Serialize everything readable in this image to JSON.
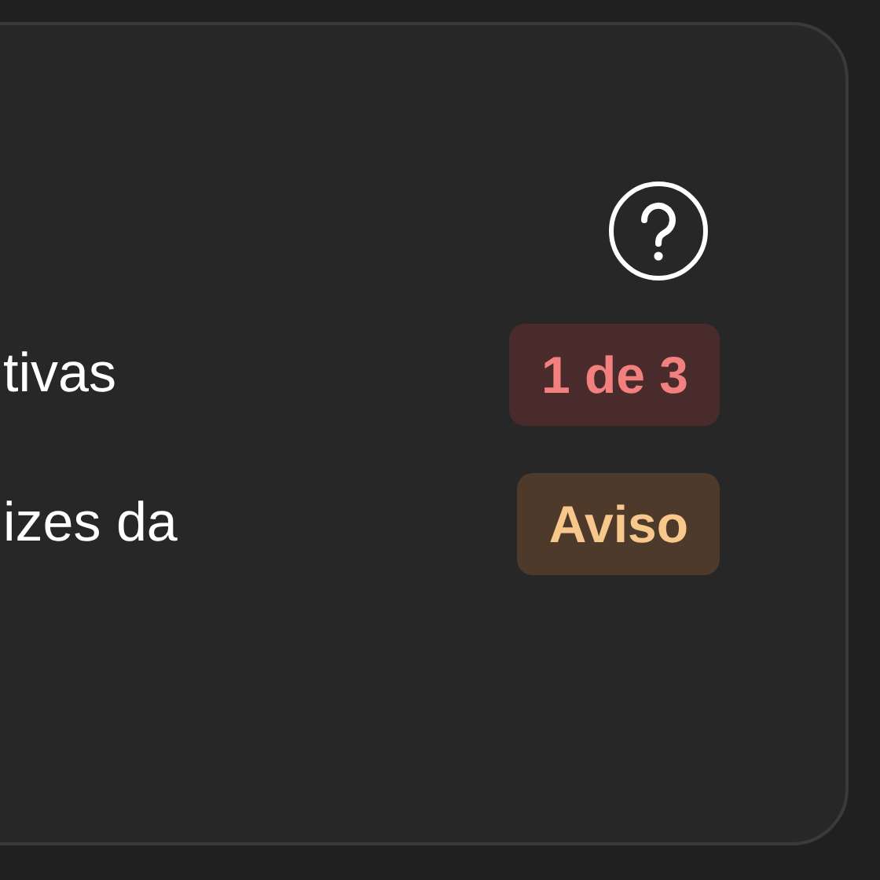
{
  "rows": [
    {
      "label": "tivas",
      "badge": "1 de 3",
      "kind": "error"
    },
    {
      "label": "izes da",
      "badge": "Aviso",
      "kind": "warning"
    }
  ]
}
